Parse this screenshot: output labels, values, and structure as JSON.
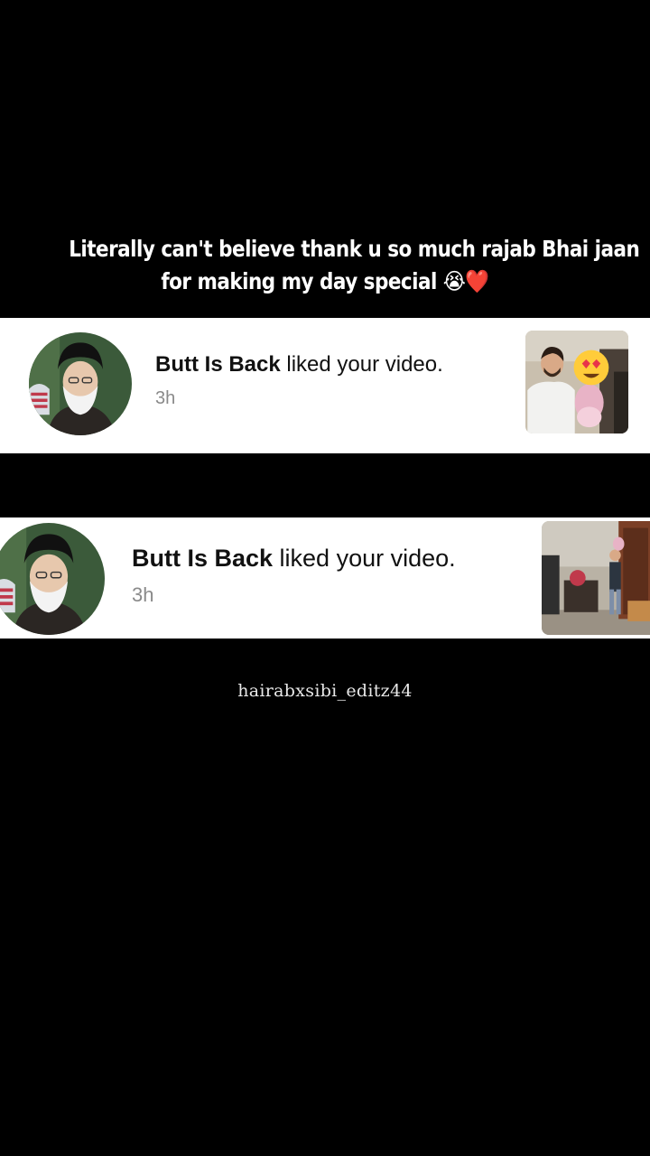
{
  "caption": {
    "line1": "Literally can't believe thank u so much rajab Bhai jaan",
    "line2": "for making my day special 😭❤️"
  },
  "notifications": [
    {
      "username": "Butt Is Back",
      "action": " liked your video.",
      "time": "3h",
      "avatar_icon": "profile-photo-icon",
      "thumbnail_icon": "video-thumbnail-icon"
    },
    {
      "username": "Butt Is Back",
      "action": " liked your video.",
      "time": "3h",
      "avatar_icon": "profile-photo-icon",
      "thumbnail_icon": "video-thumbnail-icon"
    }
  ],
  "watermark": "hairabxsibi_editz44",
  "colors": {
    "background": "#000000",
    "card": "#ffffff",
    "text": "#111111",
    "muted": "#8a8a8a"
  }
}
